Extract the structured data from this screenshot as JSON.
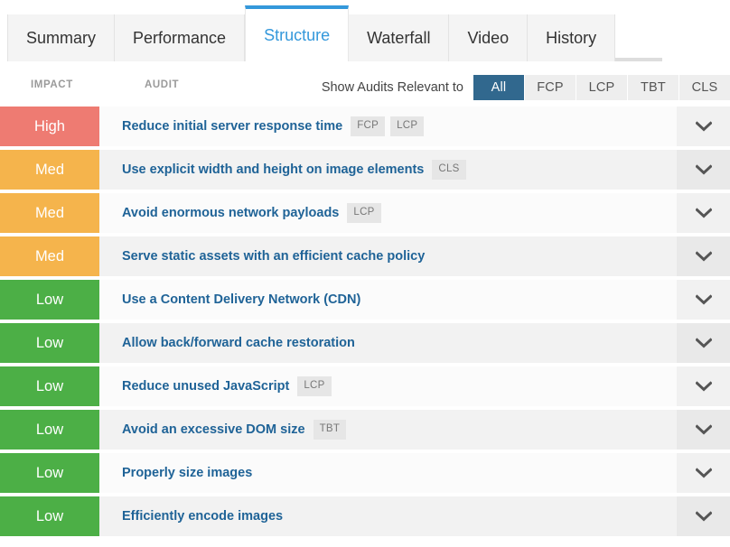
{
  "tabs": [
    {
      "label": "Summary",
      "active": false
    },
    {
      "label": "Performance",
      "active": false
    },
    {
      "label": "Structure",
      "active": true
    },
    {
      "label": "Waterfall",
      "active": false
    },
    {
      "label": "Video",
      "active": false
    },
    {
      "label": "History",
      "active": false
    }
  ],
  "filter": {
    "label": "Show Audits Relevant to",
    "buttons": [
      {
        "label": "All",
        "active": true
      },
      {
        "label": "FCP",
        "active": false
      },
      {
        "label": "LCP",
        "active": false
      },
      {
        "label": "TBT",
        "active": false
      },
      {
        "label": "CLS",
        "active": false
      }
    ]
  },
  "table": {
    "headers": {
      "impact": "IMPACT",
      "audit": "AUDIT"
    },
    "expand_icon": "chevron-down-icon",
    "rows": [
      {
        "impact": "High",
        "level": "high",
        "title": "Reduce initial server response time",
        "tags": [
          "FCP",
          "LCP"
        ]
      },
      {
        "impact": "Med",
        "level": "med",
        "title": "Use explicit width and height on image elements",
        "tags": [
          "CLS"
        ]
      },
      {
        "impact": "Med",
        "level": "med",
        "title": "Avoid enormous network payloads",
        "tags": [
          "LCP"
        ]
      },
      {
        "impact": "Med",
        "level": "med",
        "title": "Serve static assets with an efficient cache policy",
        "tags": []
      },
      {
        "impact": "Low",
        "level": "low",
        "title": "Use a Content Delivery Network (CDN)",
        "tags": []
      },
      {
        "impact": "Low",
        "level": "low",
        "title": "Allow back/forward cache restoration",
        "tags": []
      },
      {
        "impact": "Low",
        "level": "low",
        "title": "Reduce unused JavaScript",
        "tags": [
          "LCP"
        ]
      },
      {
        "impact": "Low",
        "level": "low",
        "title": "Avoid an excessive DOM size",
        "tags": [
          "TBT"
        ]
      },
      {
        "impact": "Low",
        "level": "low",
        "title": "Properly size images",
        "tags": []
      },
      {
        "impact": "Low",
        "level": "low",
        "title": "Efficiently encode images",
        "tags": []
      }
    ]
  },
  "colors": {
    "high": "#ee7b72",
    "med": "#f5b44c",
    "low": "#4caf46",
    "active_tab": "#3498db",
    "active_filter": "#31688e",
    "audit_link": "#1f6397"
  }
}
